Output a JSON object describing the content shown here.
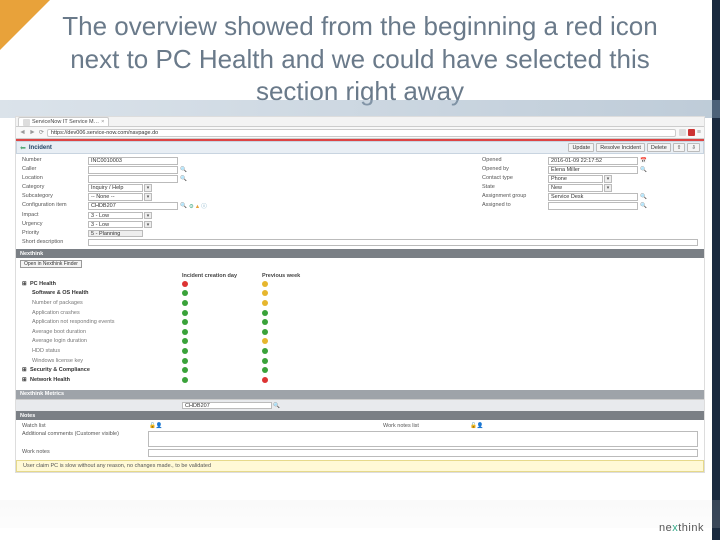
{
  "slide": {
    "title": "The overview showed from the beginning a red icon next to PC Health and we could have selected this section right away"
  },
  "browser": {
    "tab_title": "ServiceNow IT Service M…",
    "url": "https://dev006.service-now.com/navpage.do"
  },
  "form": {
    "header_title": "Incident",
    "buttons": {
      "update": "Update",
      "resolve": "Resolve Incident",
      "delete": "Delete"
    },
    "left": {
      "number": {
        "label": "Number",
        "value": "INC0010003"
      },
      "caller": {
        "label": "Caller",
        "value": ""
      },
      "location": {
        "label": "Location",
        "value": ""
      },
      "category": {
        "label": "Category",
        "value": "Inquiry / Help"
      },
      "subcategory": {
        "label": "Subcategory",
        "value": "-- None --"
      },
      "ci": {
        "label": "Configuration item",
        "value": "CHDB207"
      },
      "impact": {
        "label": "Impact",
        "value": "3 - Low"
      },
      "urgency": {
        "label": "Urgency",
        "value": "3 - Low"
      },
      "priority": {
        "label": "Priority",
        "value": "5 - Planning"
      },
      "short": {
        "label": "Short description",
        "value": ""
      }
    },
    "right": {
      "opened": {
        "label": "Opened",
        "value": "2016-01-09 22:17:52"
      },
      "opened_by": {
        "label": "Opened by",
        "value": "Elena Miller"
      },
      "contact": {
        "label": "Contact type",
        "value": "Phone"
      },
      "state": {
        "label": "State",
        "value": "New"
      },
      "group": {
        "label": "Assignment group",
        "value": "Service Desk"
      },
      "assigned": {
        "label": "Assigned to",
        "value": ""
      }
    }
  },
  "nexthink": {
    "section": "Nexthink",
    "open_finder": "Open in Nexthink Finder",
    "cols": {
      "c1": "Incident creation day",
      "c2": "Previous week"
    },
    "rows": {
      "pc_health": {
        "label": "PC Health",
        "c1": "red",
        "c2": "yellow",
        "expand": "⊞"
      },
      "soft_os": {
        "label": "Software & OS Health",
        "c1": "green",
        "c2": "yellow"
      },
      "pkg": {
        "label": "Number of packages",
        "c1": "green",
        "c2": "yellow"
      },
      "crash": {
        "label": "Application crashes",
        "c1": "green",
        "c2": "green"
      },
      "notresp": {
        "label": "Application not responding events",
        "c1": "green",
        "c2": "green"
      },
      "boot": {
        "label": "Average boot duration",
        "c1": "green",
        "c2": "green"
      },
      "login": {
        "label": "Average login duration",
        "c1": "green",
        "c2": "yellow"
      },
      "hdd": {
        "label": "HDD status",
        "c1": "green",
        "c2": "green"
      },
      "winlic": {
        "label": "Windows license key",
        "c1": "green",
        "c2": "green"
      },
      "sec": {
        "label": "Security & Compliance",
        "c1": "green",
        "c2": "green",
        "expand": "⊞"
      },
      "net": {
        "label": "Network Health",
        "c1": "green",
        "c2": "red",
        "expand": "⊞"
      }
    },
    "metric_bar": {
      "label": "Nexthink Metrics",
      "value": "CHDB207"
    }
  },
  "notes": {
    "section": "Notes",
    "watch": "Watch list",
    "worknotes_list": "Work notes list",
    "comments": "Additional comments (Customer visible)",
    "worknotes": "Work notes"
  },
  "yellownote": "User claim PC is slow without any reason, no changes made., to be validated",
  "brand": {
    "part1": "ne",
    "part2": "x",
    "part3": "think"
  }
}
